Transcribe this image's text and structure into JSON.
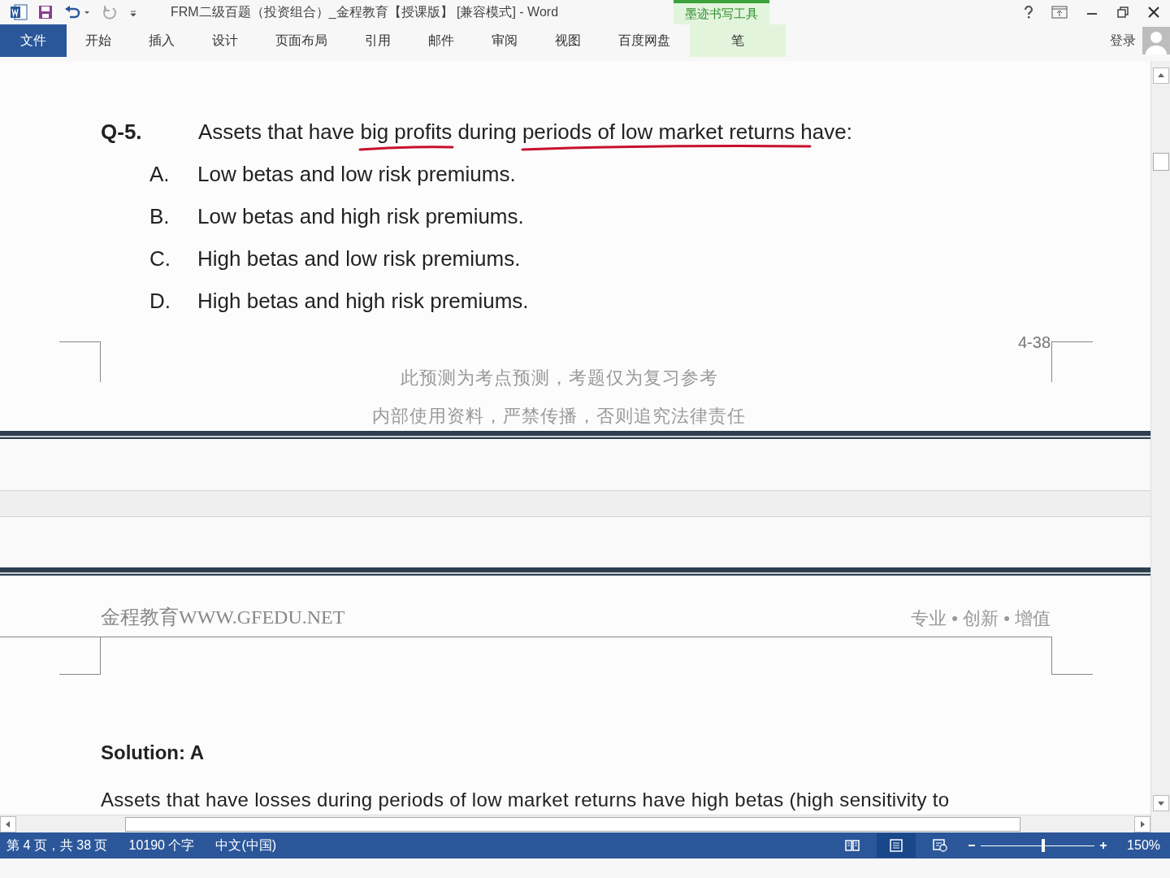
{
  "title_bar": {
    "title": "FRM二级百题（投资组合）_金程教育【授课版】 [兼容模式] - Word",
    "contextual_group": "墨迹书写工具"
  },
  "ribbon": {
    "tabs": [
      {
        "label": "文件",
        "selected": true,
        "kind": "file"
      },
      {
        "label": "开始",
        "selected": false,
        "kind": "normal"
      },
      {
        "label": "插入",
        "selected": false,
        "kind": "normal"
      },
      {
        "label": "设计",
        "selected": false,
        "kind": "normal"
      },
      {
        "label": "页面布局",
        "selected": false,
        "kind": "normal"
      },
      {
        "label": "引用",
        "selected": false,
        "kind": "normal"
      },
      {
        "label": "邮件",
        "selected": false,
        "kind": "normal"
      },
      {
        "label": "审阅",
        "selected": false,
        "kind": "normal"
      },
      {
        "label": "视图",
        "selected": false,
        "kind": "normal"
      },
      {
        "label": "百度网盘",
        "selected": false,
        "kind": "normal"
      },
      {
        "label": "笔",
        "selected": false,
        "kind": "contextual"
      }
    ],
    "sign_in": "登录"
  },
  "document": {
    "question": {
      "number": "Q-5.",
      "text": "Assets that have big profits during periods of low market returns have:",
      "options": [
        {
          "letter": "A.",
          "text": "Low betas and low risk premiums."
        },
        {
          "letter": "B.",
          "text": "Low betas and high risk premiums."
        },
        {
          "letter": "C.",
          "text": "High betas and low risk premiums."
        },
        {
          "letter": "D.",
          "text": "High betas and high risk premiums."
        }
      ]
    },
    "page_number": "4-38",
    "footer_lines": [
      "此预测为考点预测，考题仅为复习参考",
      "内部使用资料，严禁传播，否则追究法律责任"
    ],
    "header_left": "金程教育WWW.GFEDU.NET",
    "header_right": "专业 • 创新 • 增值",
    "solution_title": "Solution: A",
    "solution_text": "Assets that have losses during periods of low market returns have high betas (high sensitivity to"
  },
  "status_bar": {
    "page": "第 4 页，共 38 页",
    "words": "10190 个字",
    "language": "中文(中国)",
    "views": [
      {
        "kind": "read",
        "selected": false
      },
      {
        "kind": "print",
        "selected": true
      },
      {
        "kind": "web",
        "selected": false
      }
    ],
    "zoom": {
      "level": 0.55,
      "reading": "150%"
    }
  }
}
